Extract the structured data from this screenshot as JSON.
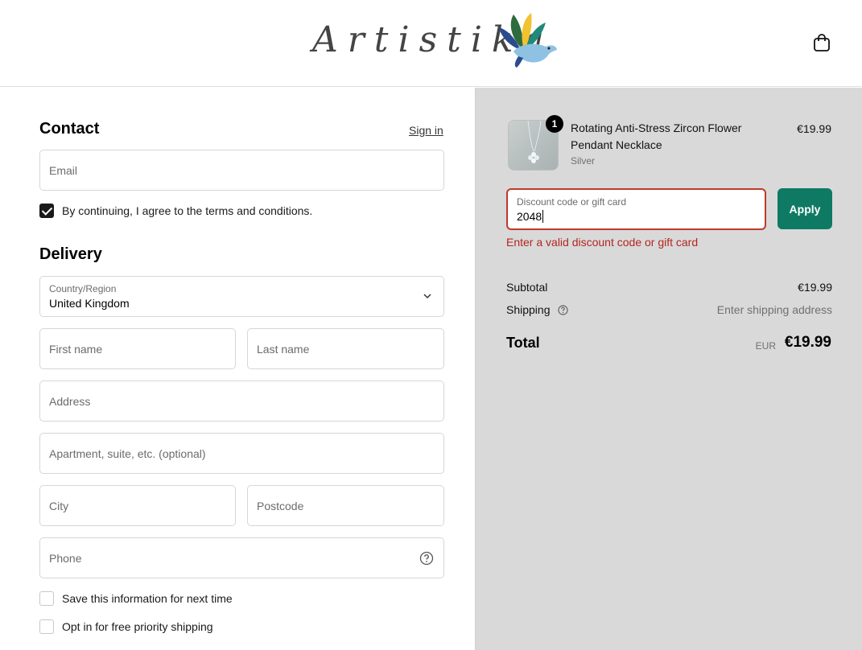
{
  "header": {
    "logo_text": "Artistika",
    "cart_icon": "shopping-bag-icon"
  },
  "contact": {
    "title": "Contact",
    "sign_in": "Sign in",
    "email_placeholder": "Email",
    "terms_label": "By continuing, I agree to the terms and conditions.",
    "terms_checked": true
  },
  "delivery": {
    "title": "Delivery",
    "country_label": "Country/Region",
    "country_value": "United Kingdom",
    "first_name_placeholder": "First name",
    "last_name_placeholder": "Last name",
    "address_placeholder": "Address",
    "apartment_placeholder": "Apartment, suite, etc. (optional)",
    "city_placeholder": "City",
    "postcode_placeholder": "Postcode",
    "phone_placeholder": "Phone",
    "save_info_label": "Save this information for next time",
    "priority_label": "Opt in for free priority shipping"
  },
  "summary": {
    "product": {
      "name": "Rotating Anti-Stress Zircon Flower Pendant Necklace",
      "variant": "Silver",
      "price": "€19.99",
      "quantity": "1"
    },
    "discount": {
      "label": "Discount code or gift card",
      "value": "2048",
      "apply_label": "Apply",
      "error": "Enter a valid discount code or gift card"
    },
    "subtotal_label": "Subtotal",
    "subtotal_value": "€19.99",
    "shipping_label": "Shipping",
    "shipping_value": "Enter shipping address",
    "total_label": "Total",
    "total_currency": "EUR",
    "total_value": "€19.99"
  },
  "colors": {
    "accent": "#0f7a64",
    "error": "#b3261e",
    "summary_bg": "#d9d9d9"
  }
}
